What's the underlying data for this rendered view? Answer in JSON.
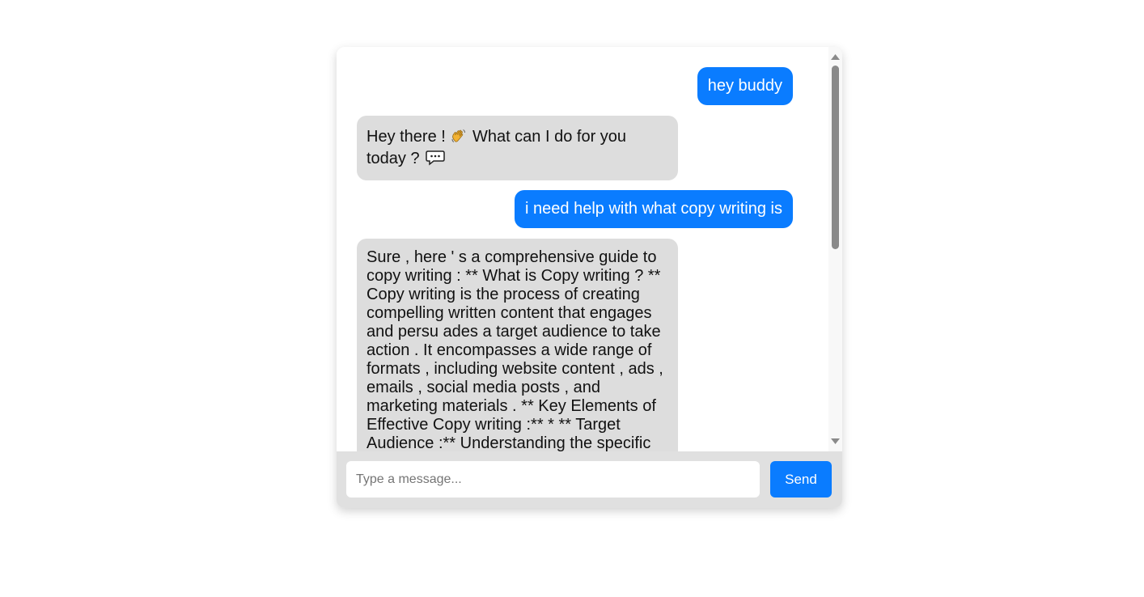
{
  "messages": [
    {
      "sender": "user",
      "text": "hey buddy"
    },
    {
      "sender": "bot",
      "text_before_wave": "Hey there ! ",
      "wave_icon": "waving-hand-emoji",
      "text_after_wave": " What can I do for you today ? ",
      "chat_icon": "speech-bubble-emoji"
    },
    {
      "sender": "user",
      "text": "i need help with what copy writing is"
    },
    {
      "sender": "bot",
      "text": "Sure , here ' s a comprehensive guide to copy writing : ** What is Copy writing ? ** Copy writing is the process of creating compelling written content that engages and persu ades a target audience to take action . It encompasses a wide range of formats , including website content , ads , emails , social media posts , and marketing materials . ** Key Elements of Effective Copy writing :** * ** Target Audience :** Understanding the specific needs and interests of your readers is essential to writing copy that resonates with them ."
    }
  ],
  "input": {
    "placeholder": "Type a message...",
    "value": ""
  },
  "send_button": {
    "label": "Send"
  },
  "colors": {
    "user_bubble": "#0a7cff",
    "bot_bubble": "#dddddd",
    "send_button": "#0a7cff",
    "input_bar": "#e0e0e0"
  }
}
